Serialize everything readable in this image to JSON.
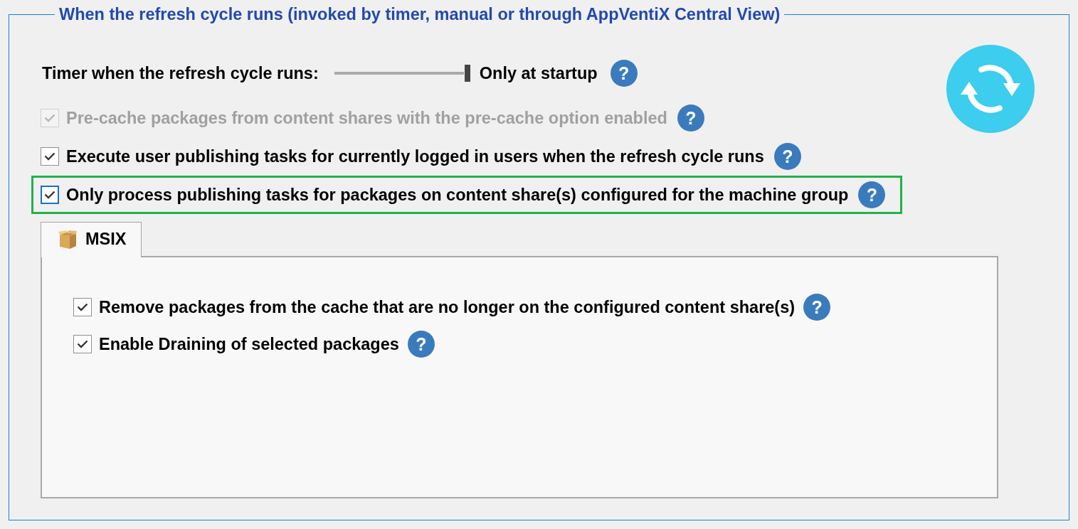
{
  "group": {
    "title": "When the refresh cycle runs (invoked by timer, manual or through AppVentiX Central View)"
  },
  "timer": {
    "label": "Timer when the refresh cycle runs:",
    "level": 1,
    "reading": "Only at startup",
    "help": "?"
  },
  "options": [
    {
      "label": "Pre-cache packages from content shares with the pre-cache option enabled",
      "checked": true,
      "disabled": true,
      "focused": false,
      "highlighted": false,
      "help": "?"
    },
    {
      "label": "Execute user publishing tasks for currently logged in users when the refresh cycle runs",
      "checked": true,
      "disabled": false,
      "focused": false,
      "highlighted": false,
      "help": "?"
    },
    {
      "label": "Only process publishing tasks for packages on content share(s) configured for the machine group",
      "checked": true,
      "disabled": false,
      "focused": true,
      "highlighted": true,
      "help": "?"
    }
  ],
  "tabs": [
    {
      "label": "MSIX",
      "selected": true
    }
  ],
  "tab_panel": {
    "options": [
      {
        "label": "Remove packages from the cache that are no longer on the configured content share(s)",
        "checked": true,
        "help": "?"
      },
      {
        "label": "Enable Draining of selected packages",
        "checked": true,
        "help": "?"
      }
    ]
  }
}
